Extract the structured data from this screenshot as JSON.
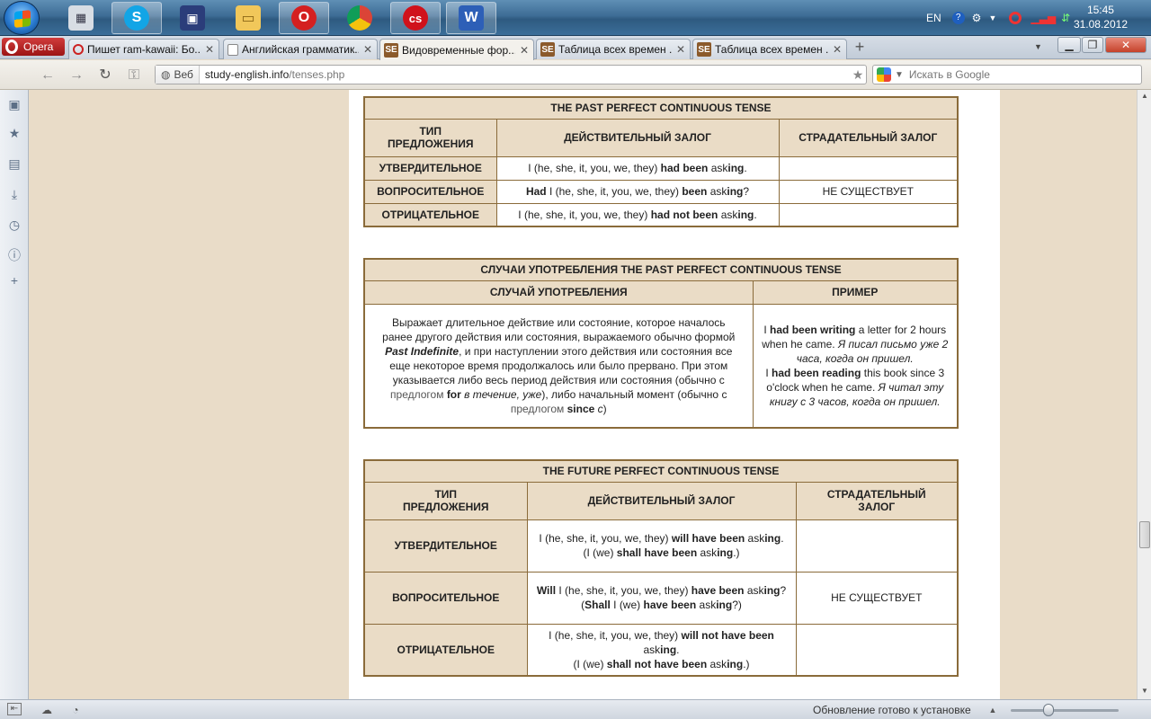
{
  "taskbar": {
    "tray_lang": "EN",
    "clock_time": "15:45",
    "clock_date": "31.08.2012"
  },
  "tabs": {
    "menu_label": "Opera",
    "items": [
      {
        "title": "Пишет ram-kawaii: Бо..."
      },
      {
        "title": "Английская грамматик..."
      },
      {
        "title": "Видовременные фор..."
      },
      {
        "title": "Таблица всех времен ..."
      },
      {
        "title": "Таблица всех времен ..."
      }
    ],
    "favicon_text": "SE"
  },
  "address": {
    "badge": "Веб",
    "domain": "study-english.info",
    "path": "/tenses.php",
    "search_placeholder": "Искать в Google"
  },
  "status": {
    "text": "Обновление готово к установке"
  },
  "table1": {
    "caption": "THE PAST PERFECT CONTINUOUS TENSE",
    "h_type": "ТИП ПРЕДЛОЖЕНИЯ",
    "h_active": "ДЕЙСТВИТЕЛЬНЫЙ ЗАЛОГ",
    "h_passive": "СТРАДАТЕЛЬНЫЙ ЗАЛОГ",
    "rows": [
      {
        "type": "УТВЕРДИТЕЛЬНОЕ",
        "a1": "I (he, she, it, you, we, they) ",
        "b1": "had been",
        "a2": " ask",
        "b2": "ing",
        "a3": "."
      },
      {
        "type": "ВОПРОСИТЕЛЬНОЕ",
        "b0": "Had",
        "a1": " I (he, she, it, you, we, they) ",
        "b1": "been",
        "a2": " ask",
        "b2": "ing",
        "a3": "?"
      },
      {
        "type": "ОТРИЦАТЕЛЬНОЕ",
        "a1": "I (he, she, it, you, we, they) ",
        "b1": "had not been",
        "a2": " ask",
        "b2": "ing",
        "a3": "."
      }
    ],
    "passive_note": "НЕ СУЩЕСТВУЕТ"
  },
  "table2": {
    "caption": "СЛУЧАИ УПОТРЕБЛЕНИЯ THE PAST PERFECT CONTINUOUS TENSE",
    "h_case": "СЛУЧАЙ УПОТРЕБЛЕНИЯ",
    "h_example": "ПРИМЕР",
    "desc_1": "Выражает длительное действие или состояние, которое началось ранее другого действия или состояния, выражаемого обычно формой ",
    "desc_term": "Past Indefinite",
    "desc_2": ", и при наступлении этого действия или состояния все еще некоторое время продолжалось или было прервано. При этом указывается либо весь период действия или состояния (обычно с ",
    "desc_prep1": "предлогом",
    "desc_for": "for",
    "desc_3": " ",
    "desc_for_tr": "в течение, уже",
    "desc_4": "), либо начальный момент (обычно с ",
    "desc_prep2": "предлогом",
    "desc_since": "since",
    "desc_5": " ",
    "desc_since_tr": "с",
    "desc_6": ")",
    "ex1_a": "I ",
    "ex1_b": "had been writing",
    "ex1_c": " a letter for 2 hours when he came. ",
    "ex1_tr": "Я писал письмо уже 2 часа, когда он пришел.",
    "ex2_a": "I ",
    "ex2_b": "had been reading",
    "ex2_c": " this book since 3 o'clock when he came. ",
    "ex2_tr": "Я читал эту книгу с 3 часов, когда он пришел."
  },
  "table3": {
    "caption": "THE FUTURE PERFECT CONTINUOUS TENSE",
    "h_type": "ТИП ПРЕДЛОЖЕНИЯ",
    "h_active": "ДЕЙСТВИТЕЛЬНЫЙ ЗАЛОГ",
    "h_passive": "СТРАДАТЕЛЬНЫЙ ЗАЛОГ",
    "rows": [
      {
        "type": "УТВЕРДИТЕЛЬНОЕ",
        "l1_a": "I (he, she, it, you, we, they) ",
        "l1_b": "will have been",
        "l1_c": " ask",
        "l1_d": "ing",
        "l1_e": ".",
        "l2_a": "(I (we) ",
        "l2_b": "shall have been",
        "l2_c": " ask",
        "l2_d": "ing",
        "l2_e": ".)"
      },
      {
        "type": "ВОПРОСИТЕЛЬНОЕ",
        "l1_a": "",
        "l1_p": "Will",
        "l1_q": " I (he, she, it, you, we, they) ",
        "l1_b": "have been",
        "l1_c": " ask",
        "l1_d": "ing",
        "l1_e": "?",
        "l2_a": "(",
        "l2_p": "Shall",
        "l2_q": " I (we) ",
        "l2_b": "have been",
        "l2_c": " ask",
        "l2_d": "ing",
        "l2_e": "?)"
      },
      {
        "type": "ОТРИЦАТЕЛЬНОЕ",
        "l1_a": "I (he, she, it, you, we, they) ",
        "l1_b": "will not have been",
        "l1_c": " ask",
        "l1_d": "ing",
        "l1_e": ".",
        "l2_a": "(I (we) ",
        "l2_b": "shall not have been",
        "l2_c": " ask",
        "l2_d": "ing",
        "l2_e": ".)"
      }
    ],
    "passive_note": "НЕ СУЩЕСТВУЕТ"
  }
}
